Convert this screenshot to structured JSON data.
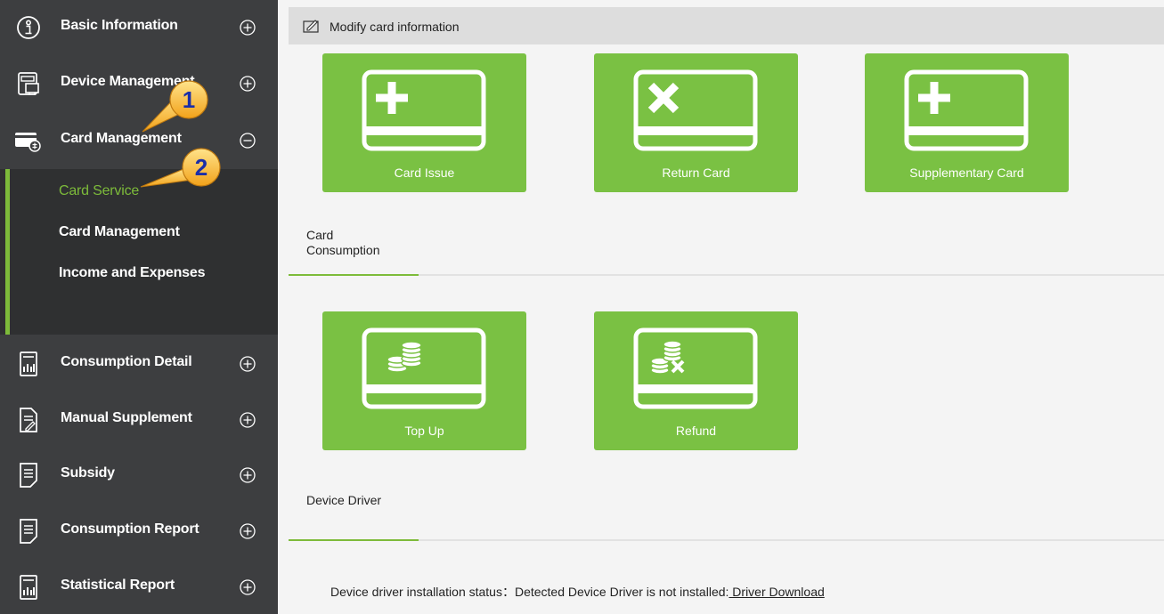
{
  "sidebar": {
    "items": [
      {
        "label": "Basic Information",
        "icon": "info-icon",
        "state": "collapsed"
      },
      {
        "label": "Device Management",
        "icon": "device-icon",
        "state": "collapsed"
      },
      {
        "label": "Card Management",
        "icon": "card-icon",
        "state": "expanded"
      },
      {
        "label": "Consumption Detail",
        "icon": "report-icon",
        "state": "collapsed"
      },
      {
        "label": "Manual Supplement",
        "icon": "manual-icon",
        "state": "collapsed"
      },
      {
        "label": "Subsidy",
        "icon": "document-icon",
        "state": "collapsed"
      },
      {
        "label": "Consumption Report",
        "icon": "document-icon",
        "state": "collapsed"
      },
      {
        "label": "Statistical Report",
        "icon": "report-icon",
        "state": "collapsed"
      }
    ],
    "submenu": [
      {
        "label": "Card Service",
        "active": true
      },
      {
        "label": "Card Management",
        "active": false
      },
      {
        "label": "Income and Expenses",
        "active": false
      }
    ]
  },
  "callouts": [
    "1",
    "2"
  ],
  "main": {
    "title": "Modify card information",
    "tiles_top": [
      {
        "label": "Card Issue",
        "icon": "card-plus-icon"
      },
      {
        "label": "Return Card",
        "icon": "card-x-icon"
      },
      {
        "label": "Supplementary Card",
        "icon": "card-plus-icon"
      }
    ],
    "section_consumption_line1": "Card",
    "section_consumption_line2": "Consumption",
    "tiles_consumption": [
      {
        "label": "Top Up",
        "icon": "coins-card-icon"
      },
      {
        "label": "Refund",
        "icon": "coins-refund-icon"
      }
    ],
    "section_driver": "Device Driver",
    "status_text": "Device driver installation status：Detected Device Driver is not installed:",
    "driver_link": " Driver Download"
  },
  "colors": {
    "sidebar_bg": "#3d3e40",
    "submenu_bg": "#2f3031",
    "accent": "#7dbb3a",
    "tile": "#7ac143",
    "content_bg": "#f4f4f4"
  }
}
